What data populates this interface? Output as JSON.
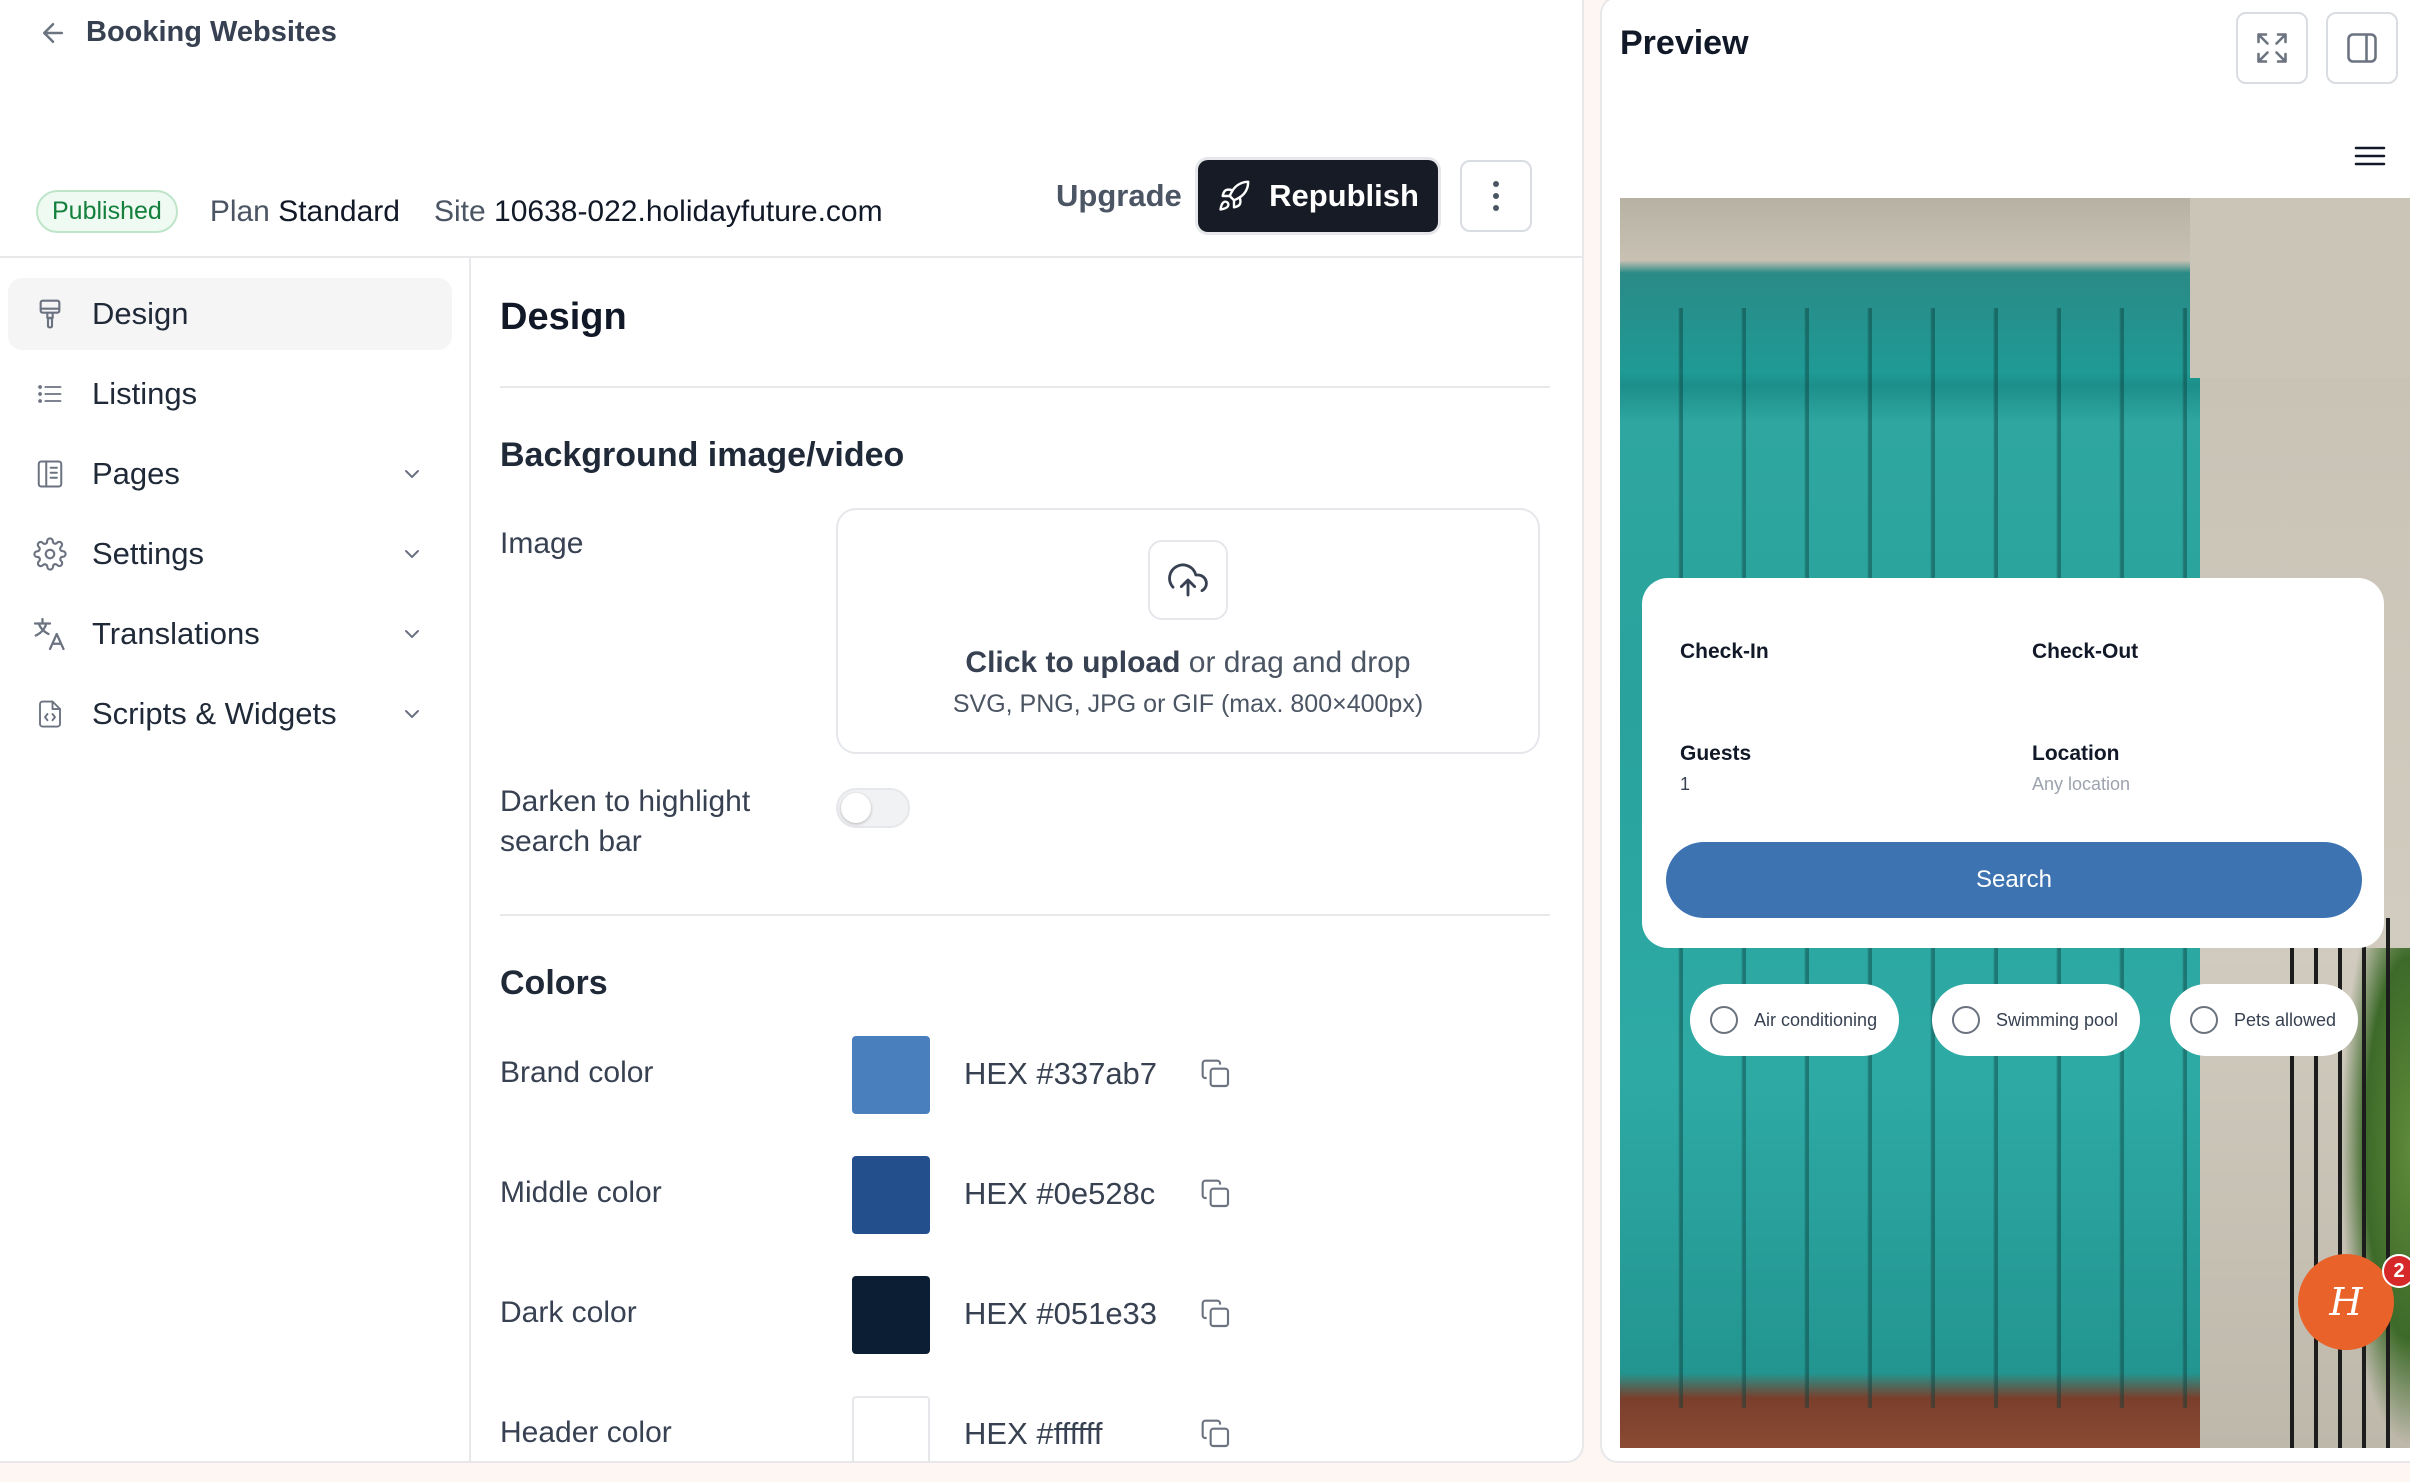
{
  "header": {
    "back_label": "Booking Websites",
    "status": "Published",
    "plan_prefix": "Plan",
    "plan_value": "Standard",
    "site_prefix": "Site",
    "site_value": "10638-022.holidayfuture.com",
    "upgrade_label": "Upgrade",
    "republish_label": "Republish"
  },
  "sidebar": {
    "items": [
      {
        "label": "Design",
        "icon": "paint-roller-icon",
        "active": true
      },
      {
        "label": "Listings",
        "icon": "list-icon"
      },
      {
        "label": "Pages",
        "icon": "pages-icon",
        "expandable": true
      },
      {
        "label": "Settings",
        "icon": "gear-icon",
        "expandable": true
      },
      {
        "label": "Translations",
        "icon": "translate-icon",
        "expandable": true
      },
      {
        "label": "Scripts & Widgets",
        "icon": "code-file-icon",
        "expandable": true
      }
    ]
  },
  "design": {
    "title": "Design",
    "background_section": "Background image/video",
    "image_label": "Image",
    "upload_strong": "Click to upload",
    "upload_rest": " or drag and drop",
    "upload_hint": "SVG, PNG, JPG or GIF (max. 800×400px)",
    "darken_label_1": "Darken to highlight",
    "darken_label_2": "search bar",
    "darken_enabled": false,
    "colors_section": "Colors",
    "colors": [
      {
        "label": "Brand color",
        "hex_text": "HEX #337ab7",
        "swatch": "#4a7fbd"
      },
      {
        "label": "Middle color",
        "hex_text": "HEX #0e528c",
        "swatch": "#234f8c"
      },
      {
        "label": "Dark color",
        "hex_text": "HEX #051e33",
        "swatch": "#0b1e34"
      },
      {
        "label": "Header color",
        "hex_text": "HEX #ffffff",
        "swatch": "#ffffff"
      }
    ]
  },
  "preview": {
    "title": "Preview",
    "checkin": "Check-In",
    "checkout": "Check-Out",
    "guests_label": "Guests",
    "guests_value": "1",
    "location_label": "Location",
    "location_placeholder": "Any location",
    "search_label": "Search",
    "amenities": [
      "Air conditioning",
      "Swimming pool",
      "Pets allowed"
    ],
    "helper_glyph": "H",
    "notification_count": "2"
  }
}
